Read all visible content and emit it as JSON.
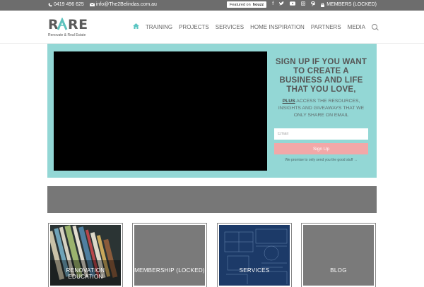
{
  "topbar": {
    "phone": "0419 496 625",
    "email": "info@The2Belindas.com.au",
    "houzz_prefix": "Featured on",
    "houzz_brand": "houzz",
    "members": "MEMBERS (LOCKED)",
    "icons": [
      "phone-icon",
      "mail-icon",
      "facebook-icon",
      "twitter-icon",
      "youtube-icon",
      "instagram-icon",
      "pinterest-icon",
      "lock-icon"
    ]
  },
  "logo": {
    "mark": "RARE",
    "tagline": "Renovate & Real Estate"
  },
  "nav": {
    "items": [
      "TRAINING",
      "PROJECTS",
      "SERVICES",
      "HOME INSPIRATION",
      "PARTNERS",
      "MEDIA"
    ]
  },
  "hero": {
    "heading": "SIGN UP IF YOU WANT TO CREATE A BUSINESS AND LIFE THAT YOU LOVE,",
    "plus": "PLUS",
    "body": " ACCESS THE RESOURCES, INSIGHTS AND GIVEAWAYS THAT WE ONLY SHARE ON EMAIL",
    "email_placeholder": "Email",
    "button": "Sign Up",
    "promise": "We promise to only send you the good stuff →"
  },
  "tiles": [
    {
      "label": "RENOVATION EDUCATION"
    },
    {
      "label": "MEMBERSHIP (LOCKED)"
    },
    {
      "label": "SERVICES"
    },
    {
      "label": "BLOG"
    }
  ],
  "colors": {
    "accent_teal": "#93d7d5",
    "signup_button": "#f2a8a8",
    "topbar": "#6d6d6d"
  }
}
